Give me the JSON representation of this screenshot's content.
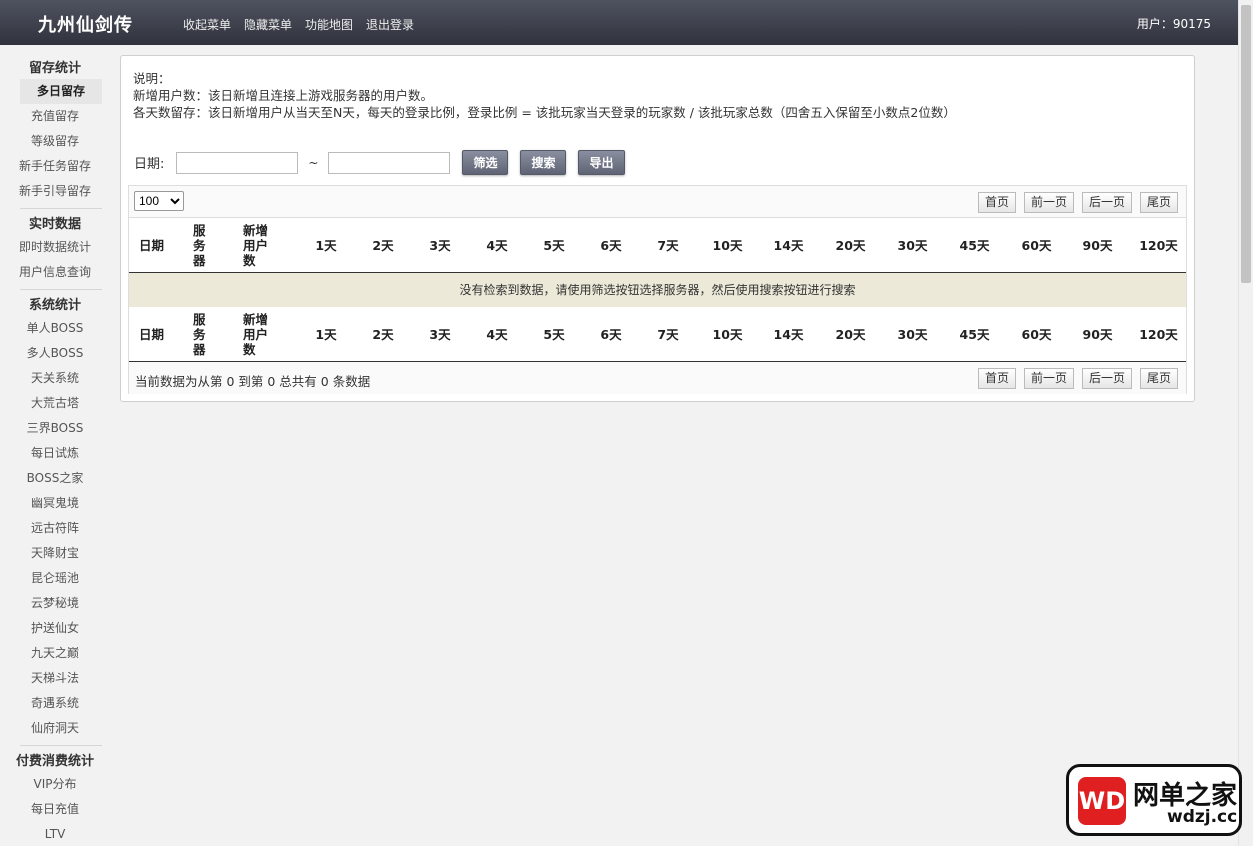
{
  "header": {
    "logo": "九州仙剑传",
    "nav": [
      "收起菜单",
      "隐藏菜单",
      "功能地图",
      "退出登录"
    ],
    "user": "用户：90175"
  },
  "sidebar": {
    "groups": [
      {
        "title": "留存统计",
        "items": [
          "多日留存",
          "充值留存",
          "等级留存",
          "新手任务留存",
          "新手引导留存"
        ],
        "active": 0
      },
      {
        "title": "实时数据",
        "items": [
          "即时数据统计",
          "用户信息查询"
        ]
      },
      {
        "title": "系统统计",
        "items": [
          "单人BOSS",
          "多人BOSS",
          "天关系统",
          "大荒古塔",
          "三界BOSS",
          "每日试炼",
          "BOSS之家",
          "幽冥鬼境",
          "远古符阵",
          "天降财宝",
          "昆仑瑶池",
          "云梦秘境",
          "护送仙女",
          "九天之巅",
          "天梯斗法",
          "奇遇系统",
          "仙府洞天"
        ]
      },
      {
        "title": "付费消费统计",
        "items": [
          "VIP分布",
          "每日充值",
          "LTV"
        ]
      }
    ]
  },
  "main": {
    "desc_title": "说明：",
    "desc_line1": "新增用户数：该日新增且连接上游戏服务器的用户数。",
    "desc_line2": "各天数留存：该日新增用户从当天至N天，每天的登录比例，登录比例 = 该批玩家当天登录的玩家数 / 该批玩家总数（四舍五入保留至小数点2位数）",
    "date_label": "日期:",
    "date_from": "",
    "date_to": "",
    "tilde": "~",
    "buttons": {
      "filter": "筛选",
      "search": "搜索",
      "export": "导出"
    },
    "page_size": "100",
    "pager": [
      "首页",
      "前一页",
      "后一页",
      "尾页"
    ],
    "columns": [
      "日期",
      "服务器",
      "新增用户数",
      "1天",
      "2天",
      "3天",
      "4天",
      "5天",
      "6天",
      "7天",
      "10天",
      "14天",
      "20天",
      "30天",
      "45天",
      "60天",
      "90天",
      "120天"
    ],
    "empty_message": "没有检索到数据，请使用筛选按钮选择服务器，然后使用搜索按钮进行搜索",
    "info": "当前数据为从第 0 到第 0 总共有 0 条数据"
  },
  "watermark": {
    "mark": "WD",
    "name": "网单之家",
    "url": "wdzj.cc"
  }
}
